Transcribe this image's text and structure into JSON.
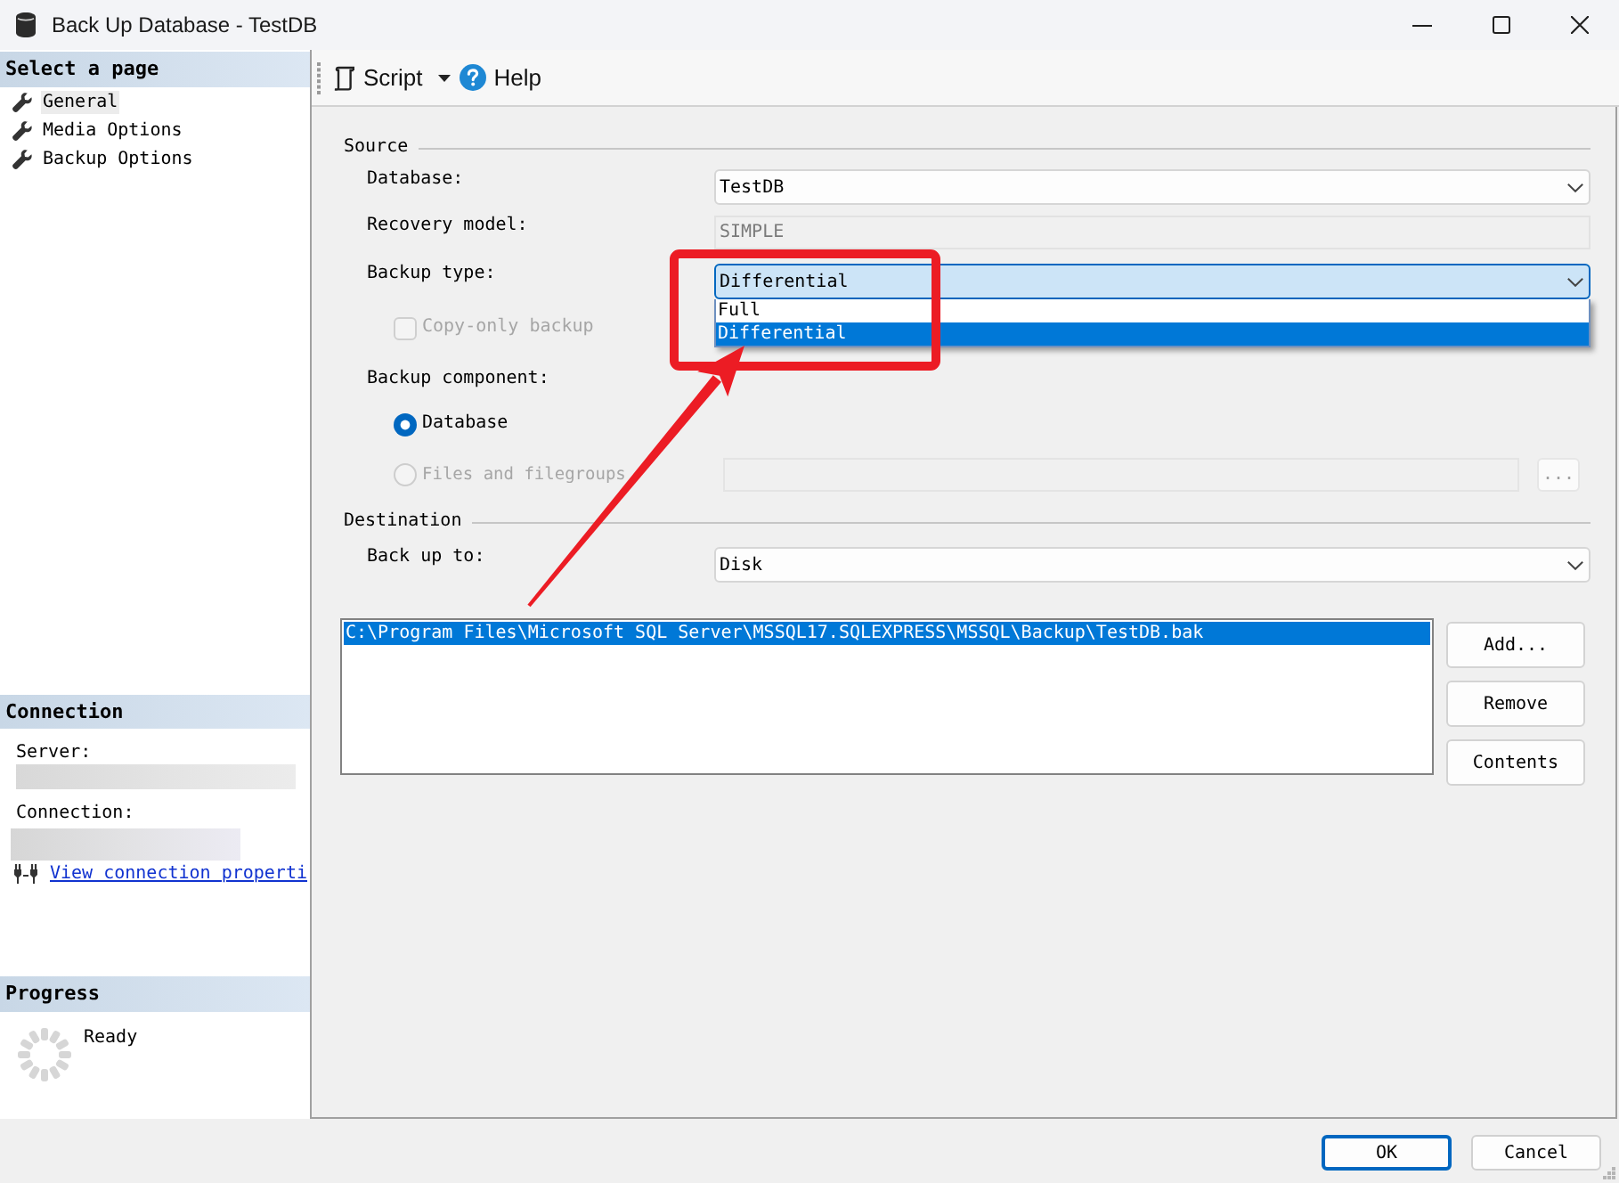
{
  "window": {
    "title": "Back Up Database - TestDB"
  },
  "sidebar": {
    "header": "Select a page",
    "pages": [
      {
        "label": "General",
        "selected": true
      },
      {
        "label": "Media Options",
        "selected": false
      },
      {
        "label": "Backup Options",
        "selected": false
      }
    ]
  },
  "connection": {
    "header": "Connection",
    "server_label": "Server:",
    "connection_label": "Connection:",
    "link": "View connection properti"
  },
  "progress": {
    "header": "Progress",
    "status": "Ready"
  },
  "toolbar": {
    "script": "Script",
    "help": "Help"
  },
  "source": {
    "title": "Source",
    "database": {
      "label": "Database:",
      "value": "TestDB"
    },
    "recovery_model": {
      "label": "Recovery model:",
      "value": "SIMPLE",
      "disabled": true
    },
    "backup_type": {
      "label": "Backup type:",
      "value": "Differential",
      "expanded": true,
      "options": [
        {
          "label": "Full",
          "selected": false
        },
        {
          "label": "Differential",
          "selected": true
        }
      ]
    },
    "copy_only": {
      "label": "Copy-only backup",
      "checked": false,
      "disabled": true
    },
    "backup_component": {
      "label": "Backup component:",
      "options": [
        {
          "label": "Database",
          "selected": true,
          "disabled": false
        },
        {
          "label": "Files and filegroups",
          "selected": false,
          "disabled": true
        }
      ],
      "browse": "..."
    }
  },
  "destination": {
    "title": "Destination",
    "back_up_to": {
      "label": "Back up to:",
      "value": "Disk"
    },
    "files": [
      {
        "path": "C:\\Program Files\\Microsoft SQL Server\\MSSQL17.SQLEXPRESS\\MSSQL\\Backup\\TestDB.bak",
        "selected": true
      }
    ],
    "buttons": [
      "Add...",
      "Remove",
      "Contents"
    ]
  },
  "buttons": [
    {
      "label": "OK",
      "default": true
    },
    {
      "label": "Cancel",
      "default": false
    }
  ]
}
